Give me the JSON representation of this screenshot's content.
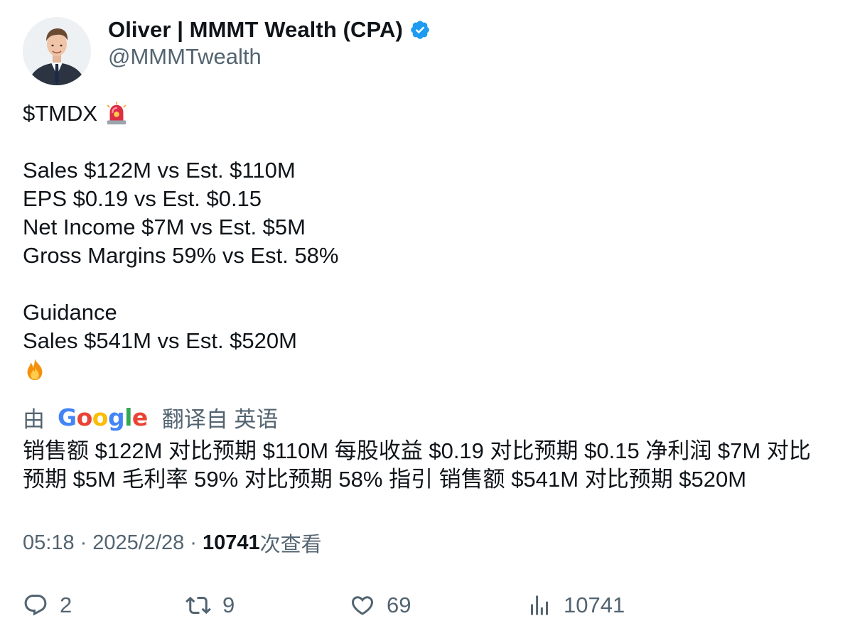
{
  "author": {
    "display_name": "Oliver | MMMT Wealth (CPA)",
    "handle": "@MMMTwealth"
  },
  "tweet": {
    "ticker": "$TMDX",
    "lines_a": [
      "Sales $122M vs Est. $110M",
      "EPS $0.19 vs Est. $0.15",
      "Net Income $7M vs Est. $5M",
      "Gross Margins 59% vs Est. 58%"
    ],
    "lines_b": [
      "Guidance",
      "Sales $541M vs Est. $520M"
    ]
  },
  "translation": {
    "prefix": "由",
    "provider": "Google",
    "suffix": "翻译自 英语",
    "text": "销售额 $122M 对比预期 $110M 每股收益 $0.19 对比预期 $0.15 净利润 $7M 对比预期 $5M 毛利率 59% 对比预期 58% 指引 销售额 $541M 对比预期 $520M"
  },
  "meta": {
    "time": "05:18",
    "sep1": "·",
    "date": "2025/2/28",
    "sep2": "·",
    "views": "10741",
    "views_suffix": "次查看"
  },
  "actions": {
    "replies": "2",
    "reposts": "9",
    "likes": "69",
    "views": "10741"
  },
  "icons": {
    "verified": "verified-badge-icon",
    "siren": "rotating-light-emoji",
    "fire": "fire-emoji",
    "reply": "reply-icon",
    "repost": "repost-icon",
    "like": "heart-icon",
    "views": "bar-chart-icon"
  },
  "colors": {
    "verified_blue": "#1d9bf0",
    "text_primary": "#0f1419",
    "text_secondary": "#536471"
  }
}
